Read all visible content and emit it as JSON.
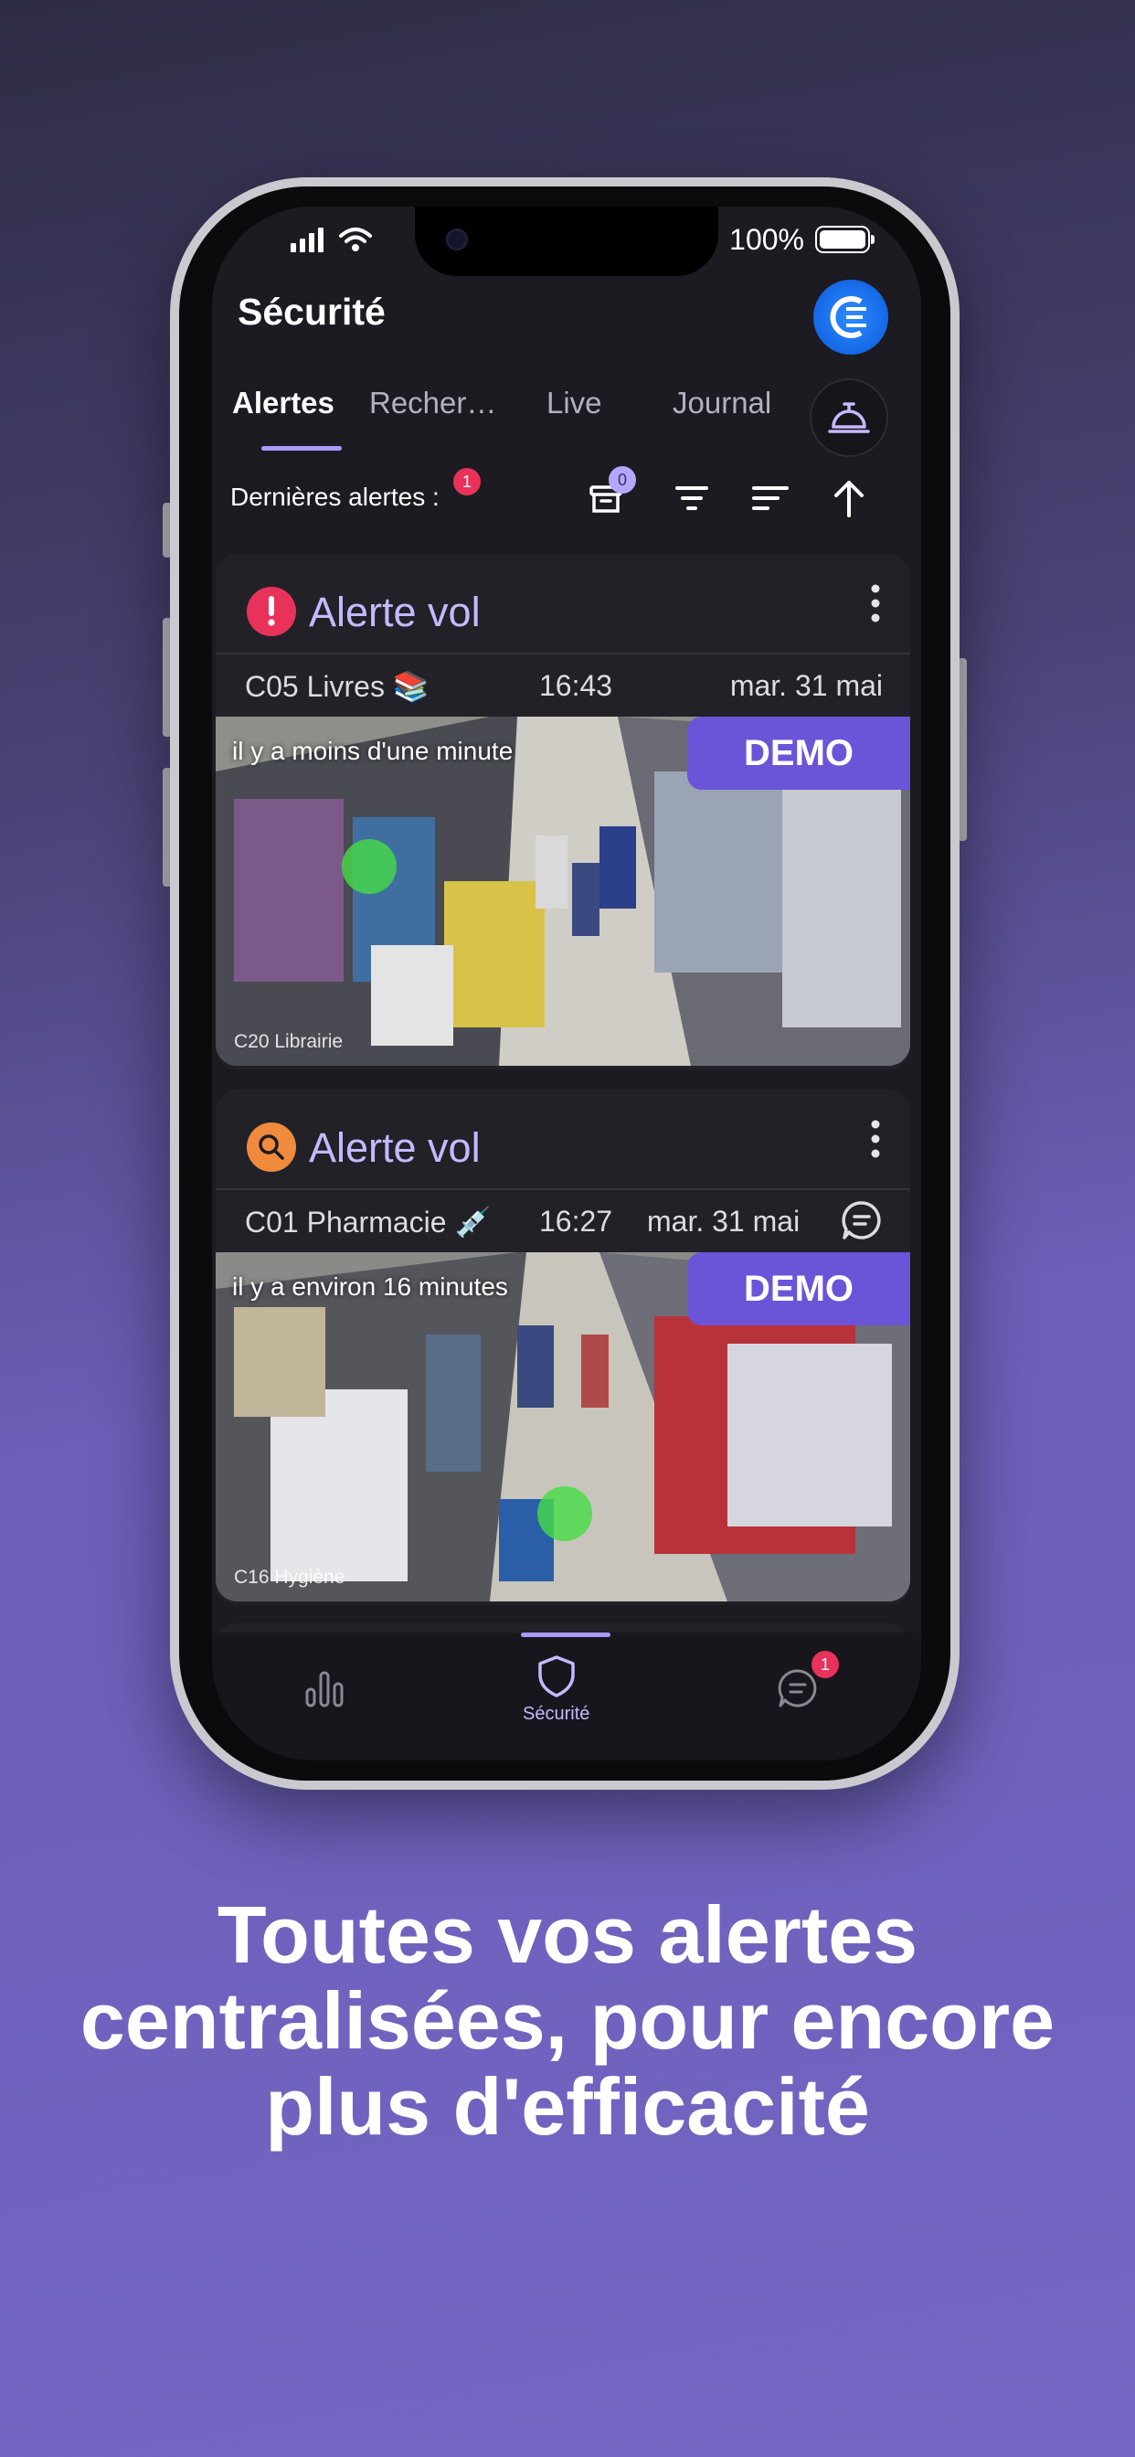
{
  "status_bar": {
    "battery": "100%"
  },
  "header": {
    "title": "Sécurité",
    "logo_icon": "brand-logo-icon"
  },
  "tabs": [
    {
      "label": "Alertes",
      "active": true
    },
    {
      "label": "Recher…",
      "active": false
    },
    {
      "label": "Live",
      "active": false
    },
    {
      "label": "Journal",
      "active": false
    }
  ],
  "toolbar": {
    "label": "Dernières alertes :",
    "alerts_badge": "1",
    "archive_badge": "0"
  },
  "alerts": [
    {
      "title": "Alerte vol",
      "severity_color": "#e8325a",
      "icon": "exclamation-icon",
      "camera": "C05 Livres 📚",
      "time": "16:43",
      "date": "mar. 31 mai",
      "relative_time": "il y a moins d'une minute",
      "demo_label": "DEMO",
      "video_label": "C20 Librairie"
    },
    {
      "title": "Alerte vol",
      "severity_color": "#f08a3c",
      "icon": "magnifier-icon",
      "camera": "C01 Pharmacie 💉",
      "time": "16:27",
      "date": "mar. 31 mai",
      "relative_time": "il y a environ 16 minutes",
      "demo_label": "DEMO",
      "video_label": "C16 Hygiène"
    }
  ],
  "bottom_nav": {
    "security_label": "Sécurité",
    "messages_badge": "1"
  },
  "headline": "Toutes vos alertes centralisées, pour encore plus d'efficacité",
  "colors": {
    "accent": "#a99aff",
    "demo": "#6a54d8",
    "badge": "#e8325a"
  }
}
